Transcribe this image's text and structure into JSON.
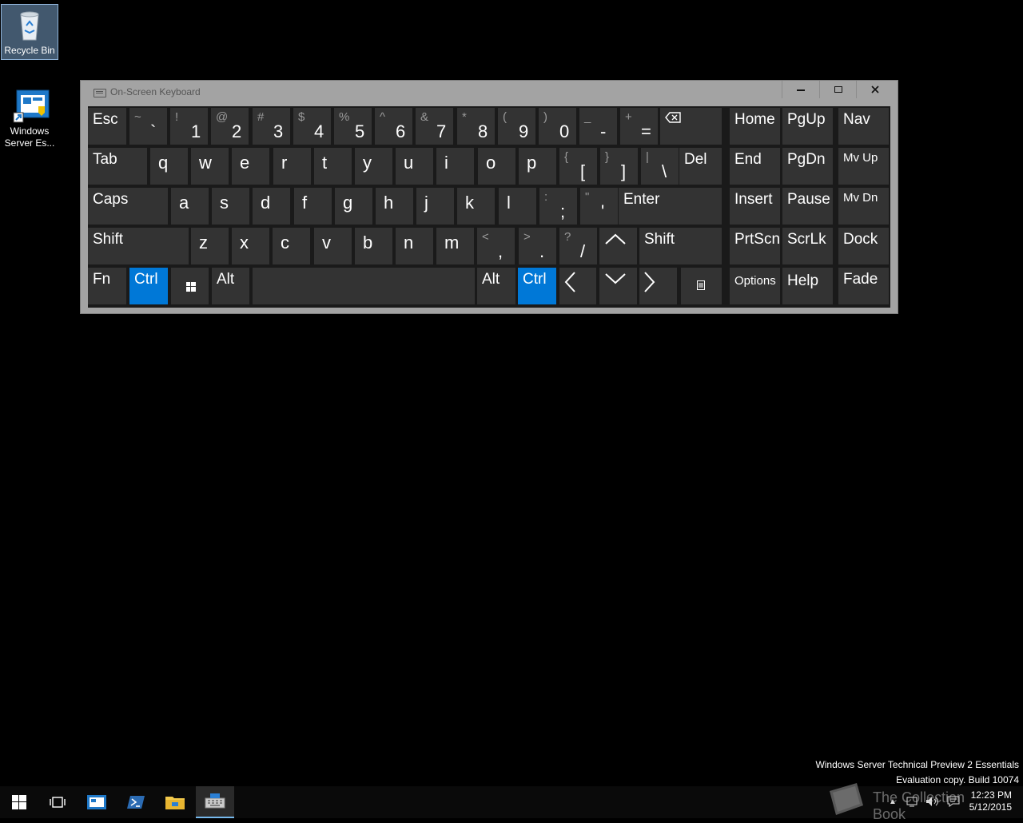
{
  "desktop": {
    "icons": [
      {
        "label": "Recycle Bin"
      },
      {
        "label": "Windows Server Es..."
      }
    ]
  },
  "osk": {
    "title": "On-Screen Keyboard",
    "keys": {
      "esc": "Esc",
      "row1": [
        {
          "sec": "~",
          "pri": "`"
        },
        {
          "sec": "!",
          "pri": "1"
        },
        {
          "sec": "@",
          "pri": "2"
        },
        {
          "sec": "#",
          "pri": "3"
        },
        {
          "sec": "$",
          "pri": "4"
        },
        {
          "sec": "%",
          "pri": "5"
        },
        {
          "sec": "^",
          "pri": "6"
        },
        {
          "sec": "&",
          "pri": "7"
        },
        {
          "sec": "*",
          "pri": "8"
        },
        {
          "sec": "(",
          "pri": "9"
        },
        {
          "sec": ")",
          "pri": "0"
        },
        {
          "sec": "_",
          "pri": "-"
        },
        {
          "sec": "+",
          "pri": "="
        }
      ],
      "tab": "Tab",
      "row2": [
        "q",
        "w",
        "e",
        "r",
        "t",
        "y",
        "u",
        "i",
        "o",
        "p"
      ],
      "row2_sym": [
        {
          "sec": "{",
          "pri": "["
        },
        {
          "sec": "}",
          "pri": "]"
        },
        {
          "sec": "|",
          "pri": "\\"
        }
      ],
      "del": "Del",
      "caps": "Caps",
      "row3": [
        "a",
        "s",
        "d",
        "f",
        "g",
        "h",
        "j",
        "k",
        "l"
      ],
      "row3_sym": [
        {
          "sec": ":",
          "pri": ";"
        },
        {
          "sec": "\"",
          "pri": "'"
        }
      ],
      "enter": "Enter",
      "shift": "Shift",
      "row4": [
        "z",
        "x",
        "c",
        "v",
        "b",
        "n",
        "m"
      ],
      "row4_sym": [
        {
          "sec": "<",
          "pri": ","
        },
        {
          "sec": ">",
          "pri": "."
        },
        {
          "sec": "?",
          "pri": "/"
        }
      ],
      "fn": "Fn",
      "ctrl": "Ctrl",
      "alt": "Alt",
      "nav": {
        "home": "Home",
        "pgup": "PgUp",
        "navk": "Nav",
        "end": "End",
        "pgdn": "PgDn",
        "mvup": "Mv Up",
        "insert": "Insert",
        "pause": "Pause",
        "mvdn": "Mv Dn",
        "prtscn": "PrtScn",
        "scrlk": "ScrLk",
        "dock": "Dock",
        "options": "Options",
        "help": "Help",
        "fade": "Fade"
      }
    },
    "active_color": "#0078d7"
  },
  "watermark": {
    "line1": "Windows Server Technical Preview 2 Essentials",
    "line2": "Evaluation copy. Build 10074"
  },
  "taskbar": {
    "time": "12:23 PM",
    "date": "5/12/2015",
    "overlay_text": "The Collection Book"
  }
}
